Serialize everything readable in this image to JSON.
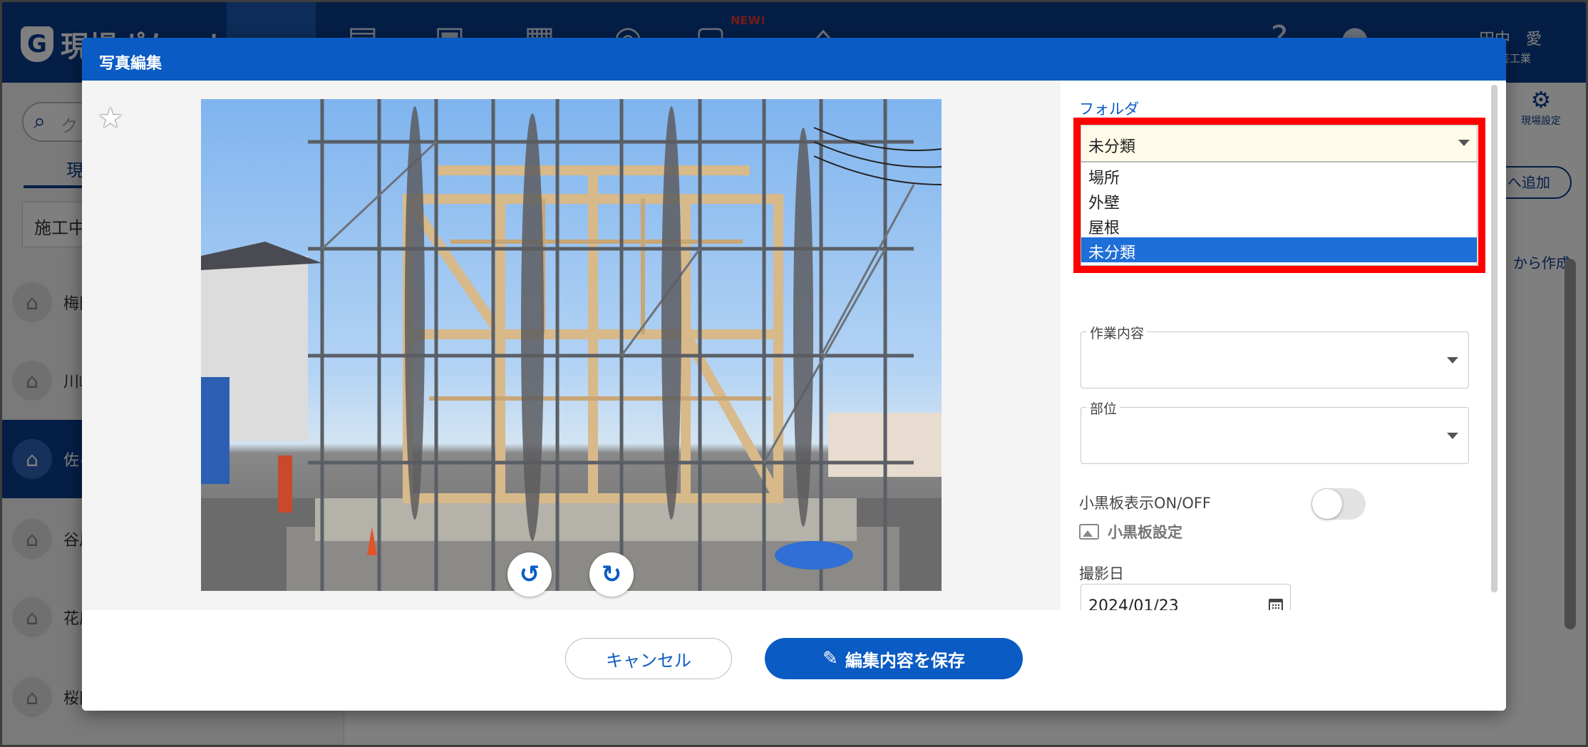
{
  "app": {
    "logo_text": "現場ポケット",
    "new_badge": "NEW!",
    "user_name": "田中　愛",
    "user_company": "芸工業",
    "search_placeholder": "ク",
    "sidebar_tab": "現",
    "sidebar_filter": "施工中",
    "sidebar_items": [
      "梅田",
      "川崎",
      "佐々",
      "谷川",
      "花房",
      "桜田"
    ],
    "settings_label": "現場設定",
    "add_button": "へ追加",
    "create_link": "から作成"
  },
  "modal": {
    "title": "写真編集",
    "folder": {
      "label": "フォルダ",
      "selected": "未分類",
      "options": [
        "場所",
        "外壁",
        "屋根",
        "未分類"
      ],
      "highlighted_option": "未分類"
    },
    "work_content": {
      "label": "作業内容",
      "value": ""
    },
    "part": {
      "label": "部位",
      "value": ""
    },
    "blackboard_toggle": {
      "label": "小黒板表示ON/OFF",
      "on": false
    },
    "blackboard_settings": "小黒板設定",
    "date": {
      "label": "撮影日",
      "value": "2024/01/23"
    },
    "cancel_label": "キャンセル",
    "save_label": "編集内容を保存"
  },
  "colors": {
    "header_blue": "#0a5bc3",
    "app_navy": "#0b3d8c",
    "highlight_red": "#ff0000",
    "select_bg": "#fffbe8",
    "option_selected": "#1f6fd8"
  }
}
